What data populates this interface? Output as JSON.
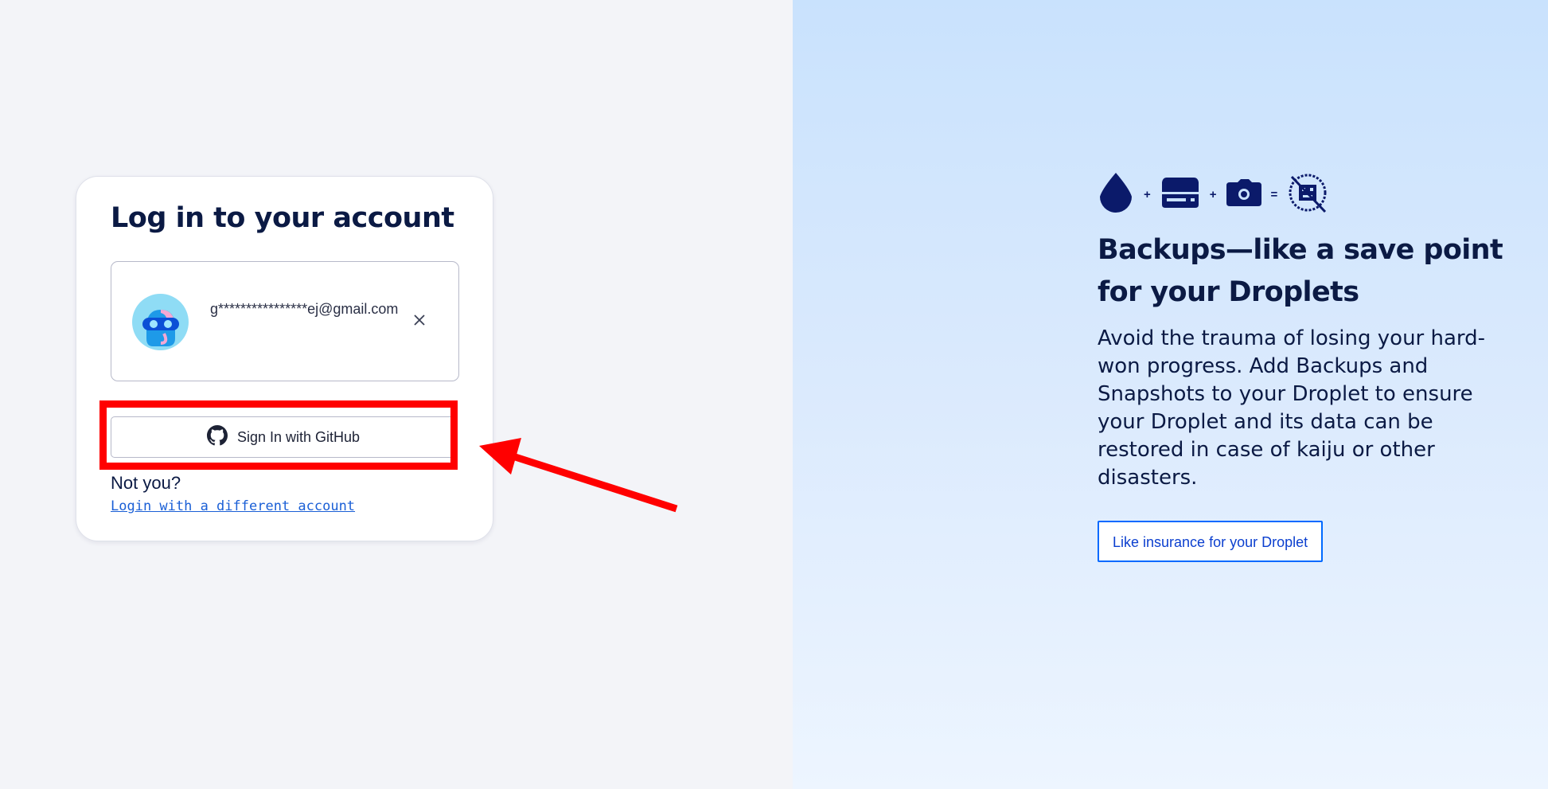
{
  "login": {
    "title": "Log in to your account",
    "account": {
      "email": "g****************ej@gmail.com",
      "avatar": "diver-mask-avatar",
      "remove_icon": "close-icon"
    },
    "github_button": {
      "label": "Sign In with GitHub",
      "icon": "github-icon"
    },
    "not_you": "Not you?",
    "different_account_link": "Login with a different account"
  },
  "promo": {
    "icons": [
      "droplet-icon",
      "plus",
      "drive-icon",
      "plus",
      "camera-icon",
      "equals",
      "no-kaiju-icon"
    ],
    "plus_symbol": "+",
    "equals_symbol": "=",
    "title": "Backups—like a save point for your Droplets",
    "body": "Avoid the trauma of losing your hard-won progress. Add Backups and Snapshots to your Droplet to ensure your Droplet and its data can be restored in case of kaiju or other disasters.",
    "button_label": "Like insurance for your Droplet"
  },
  "colors": {
    "left_background": "#f3f4f8",
    "right_background": "#c9e2fd",
    "heading": "#0b1a44",
    "link": "#1a5fd6",
    "accent_button_border": "#0069ff",
    "annotation": "#ff0000"
  }
}
